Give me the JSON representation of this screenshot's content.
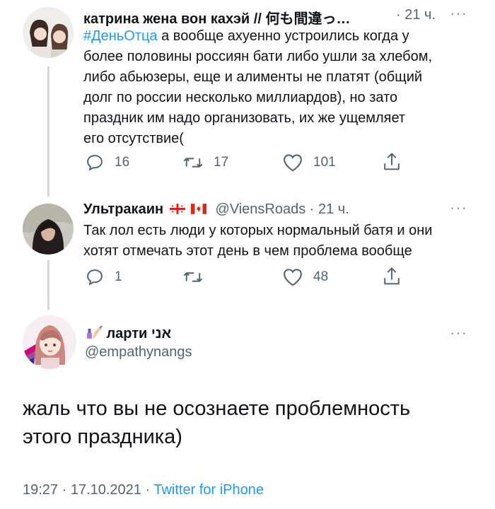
{
  "tweets": [
    {
      "display_name": "катрина жена вон кахэй // 何も間違っ…",
      "time": "· 21 ч.",
      "text_hashtag": "#ДеньОтца",
      "text_lines": [
        " а вообще ахуенно устроились когда у",
        "более половины россиян бати либо ушли за хлебом,",
        "либо абьюзеры, еще и алименты не платят (общий",
        "долг по россии несколько миллиардов), но зато",
        "праздник им надо организовать, их же ущемляет",
        "его отсутствие("
      ],
      "replies": "16",
      "retweets": "17",
      "likes": "101"
    },
    {
      "display_name": "Ультракаин",
      "handle_time": "@ViensRoads · 21 ч.",
      "text_lines": [
        "Так лол есть люди у которых нормальный батя и они",
        "хотят отмечать этот день в чем проблема вообще"
      ],
      "replies": "1",
      "retweets": "",
      "likes": "48"
    }
  ],
  "main_tweet": {
    "display_name": "ларти אני",
    "handle": "@empathynangs",
    "text_lines": [
      "жаль что вы не осознаете проблемность",
      "этого праздника)"
    ],
    "timestamp": "19:27 · 17.10.2021 · ",
    "source": "Twitter for iPhone"
  },
  "icons": {
    "more": "more-dots-icon",
    "reply": "reply-icon",
    "retweet": "retweet-icon",
    "like": "heart-icon",
    "share": "share-icon"
  },
  "colors": {
    "link": "#1d9bf0",
    "secondary_text": "#536471",
    "thread_line": "#cfd9de"
  }
}
